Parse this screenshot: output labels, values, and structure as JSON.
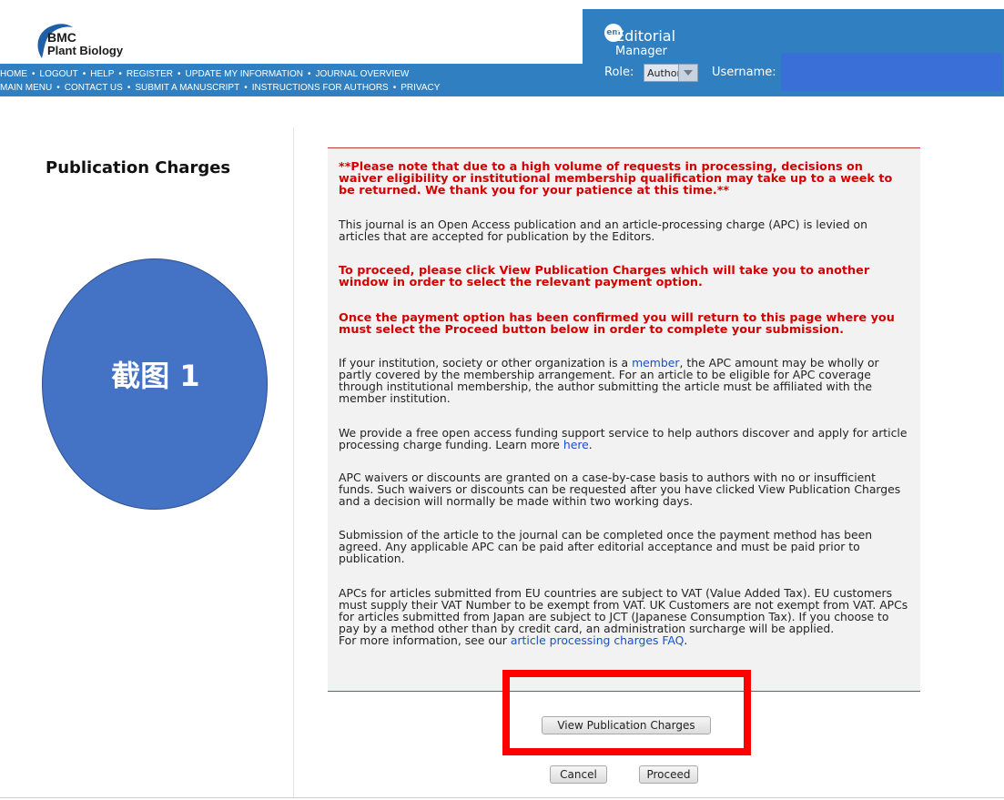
{
  "header": {
    "brand_line1": "BMC",
    "brand_line2": "Plant Biology",
    "nav_row1": [
      "HOME",
      "LOGOUT",
      "HELP",
      "REGISTER",
      "UPDATE MY INFORMATION",
      "JOURNAL OVERVIEW"
    ],
    "nav_row2": [
      "MAIN MENU",
      "CONTACT US",
      "SUBMIT A MANUSCRIPT",
      "INSTRUCTIONS FOR AUTHORS",
      "PRIVACY"
    ],
    "nav_separator": "•",
    "em_badge": "em",
    "em_line1": "Editorial",
    "em_line2": "Manager",
    "role_label": "Role:",
    "role_value": "Author",
    "username_label": "Username:",
    "username_value": ""
  },
  "sidebar": {
    "title": "Publication Charges",
    "annotation": "截图 1"
  },
  "notice": {
    "p1_red": "**Please note that due to a high volume of requests in processing, decisions on waiver eligibility or institutional membership qualification may take up to a week to be returned. We thank you for your patience at this time.**",
    "p2": "This journal is an Open Access publication and an article-processing charge (APC) is levied on articles that are accepted for publication by the Editors.",
    "p3_red": "To proceed, please click View Publication Charges which will take you to another window in order to select the relevant payment option.",
    "p4_red": "Once the payment option has been confirmed you will return to this page where you must select the Proceed button below in order to complete your submission.",
    "p5_before": "If your institution, society or other organization is a ",
    "p5_link": "member",
    "p5_after": ", the APC amount may be wholly or partly covered by the membership arrangement. For an article to be eligible for APC coverage through institutional membership, the author submitting the article must be affiliated with the member institution.",
    "p6_before": "We provide a free open access funding support service to help authors discover and apply for article processing charge funding. Learn more ",
    "p6_link": "here",
    "p6_after": ".",
    "p7": "APC waivers or discounts are granted on a case-by-case basis to authors with no or insufficient funds. Such waivers or discounts can be requested after you have clicked View Publication Charges and a decision will normally be made within two working days.",
    "p8": "Submission of the article to the journal can be completed once the payment method has been agreed. Any applicable APC can be paid after editorial acceptance and must be paid prior to publication.",
    "p9": "APCs for articles submitted from EU countries are subject to VAT (Value Added Tax). EU customers must supply their VAT Number to be exempt from VAT. UK Customers are not exempt from VAT. APCs for articles submitted from Japan are subject to JCT (Japanese Consumption Tax). If you choose to pay by a method other than by credit card, an administration surcharge will be applied.",
    "p9_last_before": "For more information, see our ",
    "p9_last_link": "article processing charges FAQ",
    "p9_last_after": "."
  },
  "actions": {
    "view_charges": "View Publication Charges",
    "cancel": "Cancel",
    "proceed": "Proceed"
  },
  "colors": {
    "header_blue": "#2f7fc1",
    "warning_red": "#d40000",
    "highlight_red": "#ff0000",
    "annotation_blue": "#4472c4",
    "link_blue": "#1a4fc9"
  }
}
